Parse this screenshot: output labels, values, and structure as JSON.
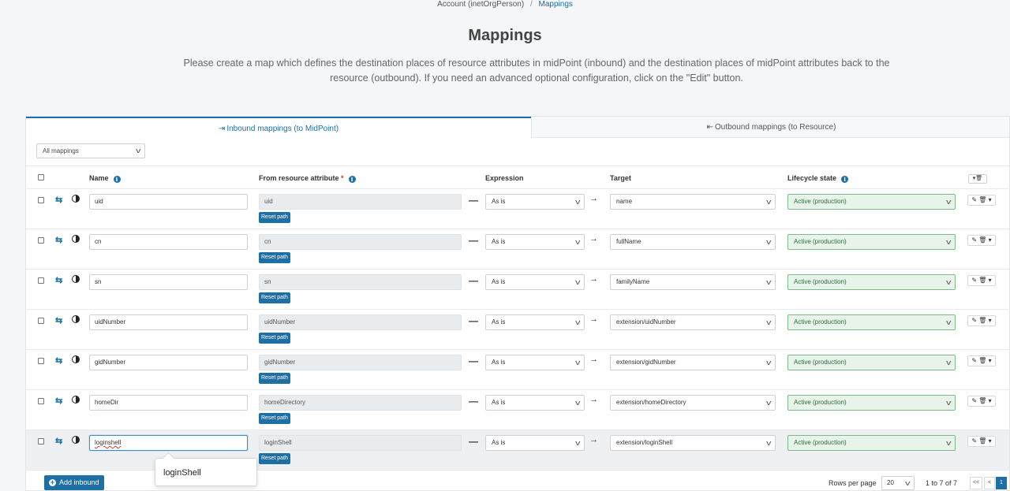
{
  "breadcrumb": {
    "parent": "Account (inetOrgPerson)",
    "separator": "/",
    "current": "Mappings"
  },
  "page": {
    "title": "Mappings",
    "description": "Please create a map which defines the destination places of resource attributes in midPoint (inbound) and the destination places of midPoint attributes back to the resource (outbound). If you need an advanced optional configuration, click on the \"Edit\" button."
  },
  "tabs": [
    {
      "label": "Inbound mappings (to MidPoint)",
      "icon": "sign-in-icon",
      "active": true
    },
    {
      "label": "Outbound mappings (to Resource)",
      "icon": "sign-out-icon",
      "active": false
    }
  ],
  "filter": {
    "value": "All mappings"
  },
  "columns": {
    "name": "Name",
    "from": "From resource attribute",
    "required_mark": "*",
    "expression": "Expression",
    "target": "Target",
    "lifecycle": "Lifecycle state"
  },
  "reset_label": "Reset path",
  "rows": [
    {
      "name": "uid",
      "attribute": "uid",
      "expression": "As is",
      "target": "name",
      "lifecycle": "Active (production)"
    },
    {
      "name": "cn",
      "attribute": "cn",
      "expression": "As is",
      "target": "fullName",
      "lifecycle": "Active (production)"
    },
    {
      "name": "sn",
      "attribute": "sn",
      "expression": "As is",
      "target": "familyName",
      "lifecycle": "Active (production)"
    },
    {
      "name": "uidNumber",
      "attribute": "uidNumber",
      "expression": "As is",
      "target": "extension/uidNumber",
      "lifecycle": "Active (production)"
    },
    {
      "name": "gidNumber",
      "attribute": "gidNumber",
      "expression": "As is",
      "target": "extension/gidNumber",
      "lifecycle": "Active (production)"
    },
    {
      "name": "homeDir",
      "attribute": "homeDirectory",
      "expression": "As is",
      "target": "extension/homeDirectory",
      "lifecycle": "Active (production)"
    },
    {
      "name": "loginshell",
      "attribute": "loginShell",
      "expression": "As is",
      "target": "extension/loginShell",
      "lifecycle": "Active (production)",
      "selected": true
    }
  ],
  "autocomplete": {
    "suggestion": "loginShell"
  },
  "footer": {
    "add_label": "Add inbound",
    "rows_per_page_label": "Rows per page",
    "rows_per_page": "20",
    "range": "1 to 7 of 7",
    "first": "<<",
    "prev": "<",
    "current_page": "1"
  },
  "colors": {
    "accent": "#1d6fa4",
    "lifecycle_bg": "#e8f3ea",
    "lifecycle_border": "#7fb98a",
    "required": "#c0392b"
  }
}
